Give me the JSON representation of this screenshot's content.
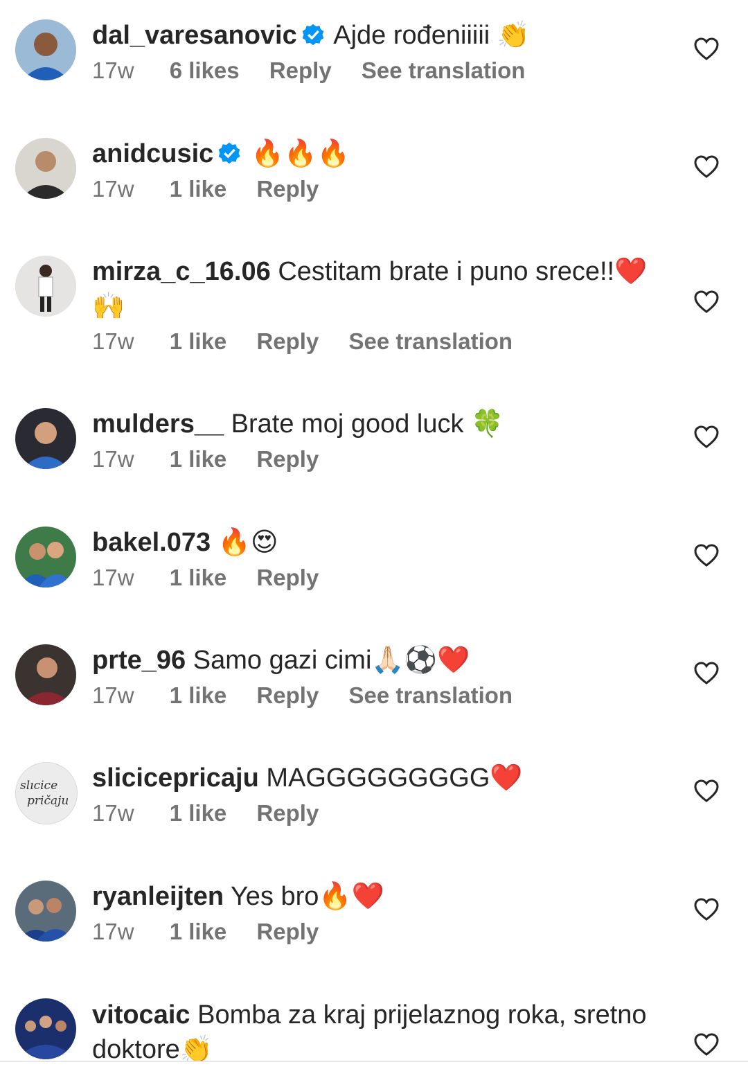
{
  "comments": [
    {
      "username": "dal_varesanovic",
      "verified": true,
      "text": "Ajde rođeniiiii 👏",
      "time": "17w",
      "likes": "6 likes",
      "reply": "Reply",
      "translation": "See translation",
      "avatar_color": "#1f5fb8"
    },
    {
      "username": "anidcusic",
      "verified": true,
      "text": "🔥🔥🔥",
      "time": "17w",
      "likes": "1 like",
      "reply": "Reply",
      "translation": "",
      "avatar_color": "#3a3a3a"
    },
    {
      "username": "mirza_c_16.06",
      "verified": false,
      "text": "Cestitam brate i puno srece!!❤️🙌",
      "time": "17w",
      "likes": "1 like",
      "reply": "Reply",
      "translation": "See translation",
      "avatar_color": "#d9d9d9"
    },
    {
      "username": "mulders__",
      "verified": false,
      "text": "Brate moj good luck 🍀",
      "time": "17w",
      "likes": "1 like",
      "reply": "Reply",
      "translation": "",
      "avatar_color": "#1d3c7a"
    },
    {
      "username": "bakel.073",
      "verified": false,
      "text": "🔥😍",
      "time": "17w",
      "likes": "1 like",
      "reply": "Reply",
      "translation": "",
      "avatar_color": "#2f6a3a"
    },
    {
      "username": "prte_96",
      "verified": false,
      "text": "Samo gazi cimi🙏🏻⚽❤️",
      "time": "17w",
      "likes": "1 like",
      "reply": "Reply",
      "translation": "See translation",
      "avatar_color": "#5a2b2b"
    },
    {
      "username": "slicicepricaju",
      "verified": false,
      "text": "MAGGGGGGGGG❤️",
      "time": "17w",
      "likes": "1 like",
      "reply": "Reply",
      "translation": "",
      "avatar_color": "#ececec"
    },
    {
      "username": "ryanleijten",
      "verified": false,
      "text": "Yes bro🔥❤️",
      "time": "17w",
      "likes": "1 like",
      "reply": "Reply",
      "translation": "",
      "avatar_color": "#1b3f8a"
    },
    {
      "username": "vitocaic",
      "verified": false,
      "text": "Bomba za kraj prijelaznog roka, sretno doktore👏",
      "time": "",
      "likes": "",
      "reply": "",
      "translation": "",
      "avatar_color": "#223a86"
    }
  ],
  "logo_text": {
    "line1": "slicice",
    "line2": "pricaju"
  },
  "colors": {
    "text": "#262626",
    "meta": "#737373",
    "verified": "#0095f6",
    "heart": "#262626"
  }
}
